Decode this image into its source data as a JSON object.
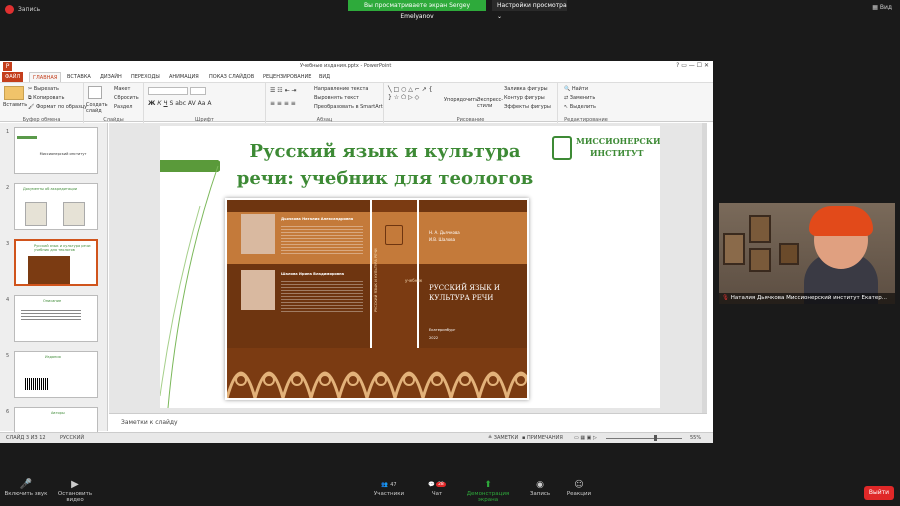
{
  "zoom": {
    "record_label": "Запись",
    "share_label": "Вы просматриваете экран Sergey Emelyanov",
    "view_options_label": "Настройки просмотра",
    "view_label": "Вид",
    "participant_name": "Наталия Дьячкова Миссионерский институт Екатер...",
    "bottom": {
      "mute": "Включить звук",
      "video": "Остановить видео",
      "participants": "Участники",
      "participants_count": "47",
      "chat": "Чат",
      "chat_badge": "28",
      "demo": "Демонстрация экрана",
      "record": "Запись",
      "reactions": "Реакции",
      "leave": "Выйти"
    }
  },
  "ppt": {
    "window_title": "Учебные издания.pptx - PowerPoint",
    "tabs": [
      "ФАЙЛ",
      "ГЛАВНАЯ",
      "ВСТАВКА",
      "ДИЗАЙН",
      "ПЕРЕХОДЫ",
      "АНИМАЦИЯ",
      "ПОКАЗ СЛАЙДОВ",
      "РЕЦЕНЗИРОВАНИЕ",
      "ВИД"
    ],
    "ribbon": {
      "paste": "Вставить",
      "cut": "Вырезать",
      "copy": "Копировать",
      "format": "Формат по образцу",
      "clipboard": "Буфер обмена",
      "new_slide": "Создать слайд",
      "layout": "Макет",
      "reset": "Сбросить",
      "section": "Раздел",
      "slides": "Слайды",
      "font": "Шрифт",
      "text_dir": "Направление текста",
      "align_text": "Выровнять текст",
      "smartart": "Преобразовать в SmartArt",
      "paragraph": "Абзац",
      "arrange": "Упорядочить",
      "quick_styles": "Экспресс-стили",
      "fill": "Заливка фигуры",
      "outline": "Контур фигуры",
      "effects": "Эффекты фигуры",
      "drawing": "Рисование",
      "find": "Найти",
      "replace": "Заменить",
      "select": "Выделить",
      "editing": "Редактирование"
    },
    "notes_placeholder": "Заметки к слайду",
    "status": {
      "slide_of": "СЛАЙД 3 ИЗ 12",
      "language": "РУССКИЙ",
      "notes": "ЗАМЕТКИ",
      "comments": "ПРИМЕЧАНИЯ",
      "zoom": "55%"
    },
    "thumbs": [
      {
        "num": "1",
        "text": "Миссионерский институт"
      },
      {
        "num": "2",
        "text": "Документы об аккредитации"
      },
      {
        "num": "3",
        "text": "Русский язык и культура речи: учебник для теологов"
      },
      {
        "num": "4",
        "text": "Описание"
      },
      {
        "num": "5",
        "text": "Издания"
      },
      {
        "num": "6",
        "text": "Авторы"
      }
    ]
  },
  "slide": {
    "title_line1": "Русский язык и культура",
    "title_line2": "речи: учебник для теологов",
    "logo_text_1": "МИССИОНЕРСКИЙ",
    "logo_text_2": "ИНСТИТУТ",
    "book": {
      "author1": "Дьячкова Наталия Александровна",
      "author2": "Шалова Ирина Владимировна",
      "authors_short_1": "Н. А. Дьячкова",
      "authors_short_2": "И.В. Шалова",
      "spine": "РУССКИЙ ЯЗЫК И КУЛЬТУРА РЕЧИ",
      "type": "учебник",
      "title_1": "РУССКИЙ ЯЗЫК И",
      "title_2": "КУЛЬТУРА РЕЧИ",
      "city": "Екатеринбург",
      "year": "2022"
    }
  }
}
